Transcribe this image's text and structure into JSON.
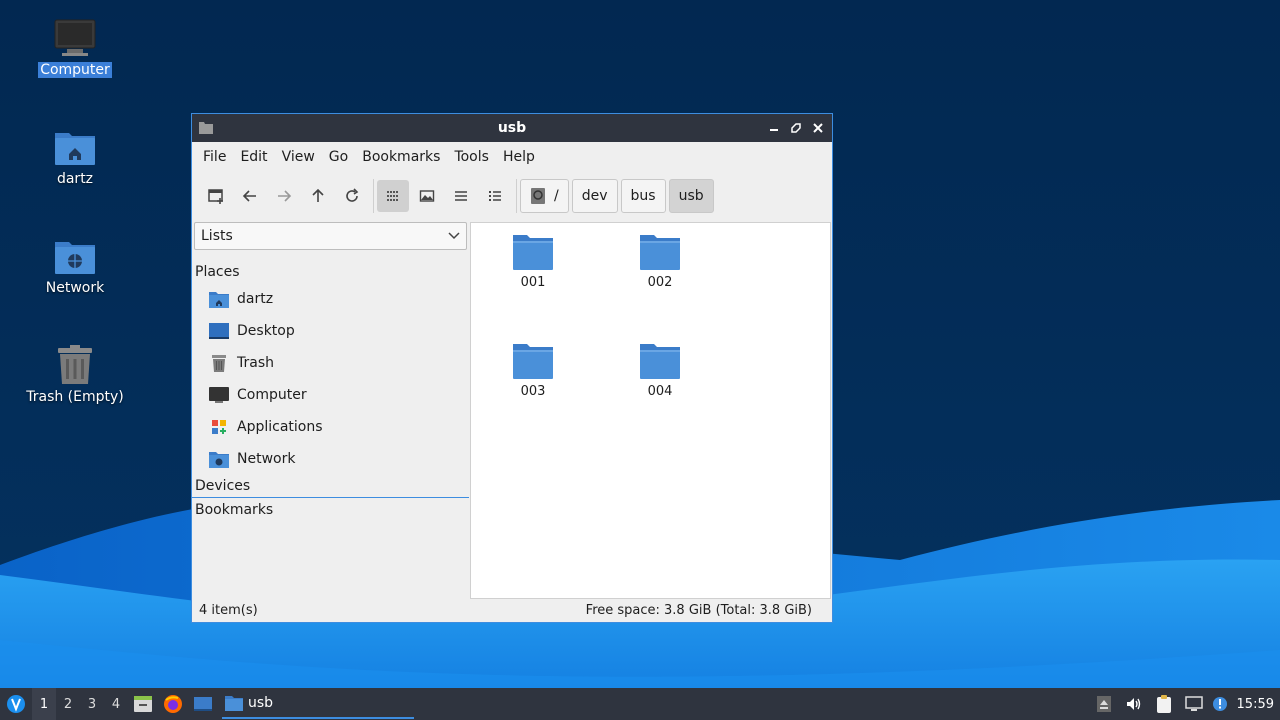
{
  "desktop": {
    "icons": [
      {
        "label": "Computer",
        "icon": "computer-icon",
        "selected": true
      },
      {
        "label": "dartz",
        "icon": "home-folder-icon"
      },
      {
        "label": "Network",
        "icon": "network-folder-icon"
      },
      {
        "label": "Trash (Empty)",
        "icon": "trash-icon"
      }
    ]
  },
  "window": {
    "title": "usb",
    "controls": {
      "minimize": "minimize-icon",
      "maximize": "maximize-icon",
      "close": "close-icon"
    },
    "menu": [
      "File",
      "Edit",
      "View",
      "Go",
      "Bookmarks",
      "Tools",
      "Help"
    ],
    "toolbar": {
      "buttons": [
        "new-tab-icon",
        "back-icon",
        "forward-icon",
        "up-icon",
        "reload-icon"
      ],
      "view_modes": [
        "icon-view-icon",
        "thumbnail-view-icon",
        "compact-view-icon",
        "detailed-list-icon"
      ],
      "active_view": "icon-view-icon"
    },
    "breadcrumbs": [
      "/",
      "dev",
      "bus",
      "usb"
    ],
    "sidepane": {
      "mode": "Lists",
      "places_header": "Places",
      "places": [
        {
          "label": "dartz",
          "icon": "home-folder-icon"
        },
        {
          "label": "Desktop",
          "icon": "desktop-icon"
        },
        {
          "label": "Trash",
          "icon": "trash-icon"
        },
        {
          "label": "Computer",
          "icon": "computer-icon"
        },
        {
          "label": "Applications",
          "icon": "applications-icon"
        },
        {
          "label": "Network",
          "icon": "network-folder-icon"
        }
      ],
      "devices_header": "Devices",
      "bookmarks_header": "Bookmarks"
    },
    "files": [
      "001",
      "002",
      "003",
      "004"
    ],
    "status": {
      "items": "4 item(s)",
      "free_space": "Free space: 3.8 GiB (Total: 3.8 GiB)"
    }
  },
  "taskbar": {
    "workspaces": [
      "1",
      "2",
      "3",
      "4"
    ],
    "active_workspace": "1",
    "launchers": [
      "file-manager-icon",
      "firefox-icon",
      "show-desktop-icon"
    ],
    "task": {
      "label": "usb",
      "icon": "folder-icon"
    },
    "clock": "15:59"
  },
  "colors": {
    "accent": "#3d8de0",
    "titlebar": "#2f343f",
    "folder": "#4a90d9",
    "desktop_bg": "#032a52"
  }
}
